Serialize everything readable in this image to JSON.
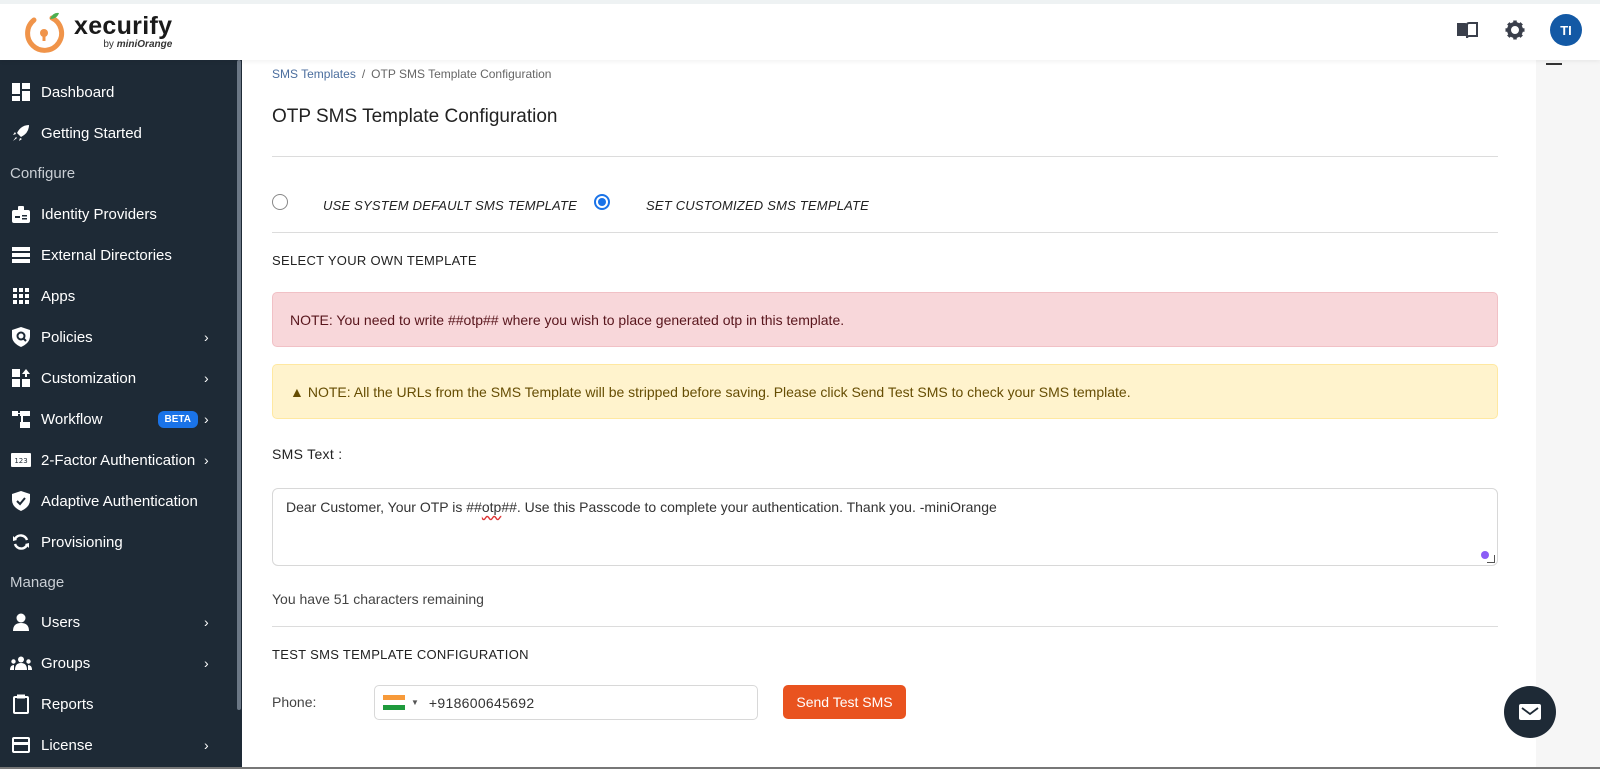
{
  "brand": {
    "name": "xecurify",
    "sub_prefix": "by ",
    "sub_brand": "miniOrange"
  },
  "header": {
    "avatar_initials": "TI",
    "icons": [
      "book-icon",
      "gear-icon"
    ]
  },
  "sidebar": {
    "items": [
      {
        "label": "Dashboard",
        "icon": "dashboard-icon"
      },
      {
        "label": "Getting Started",
        "icon": "rocket-icon"
      },
      {
        "section": "Configure"
      },
      {
        "label": "Identity Providers",
        "icon": "id-badge-icon"
      },
      {
        "label": "External Directories",
        "icon": "server-icon"
      },
      {
        "label": "Apps",
        "icon": "grid-icon"
      },
      {
        "label": "Policies",
        "icon": "shield-search-icon",
        "chevron": true
      },
      {
        "label": "Customization",
        "icon": "customization-icon",
        "chevron": true
      },
      {
        "label": "Workflow",
        "icon": "workflow-icon",
        "chevron": true,
        "badge": "BETA"
      },
      {
        "label": "2-Factor Authentication",
        "icon": "123-icon",
        "chevron": true
      },
      {
        "label": "Adaptive Authentication",
        "icon": "shield-check-icon"
      },
      {
        "label": "Provisioning",
        "icon": "sync-icon"
      },
      {
        "section": "Manage"
      },
      {
        "label": "Users",
        "icon": "user-icon",
        "chevron": true
      },
      {
        "label": "Groups",
        "icon": "users-icon",
        "chevron": true
      },
      {
        "label": "Reports",
        "icon": "clipboard-icon"
      },
      {
        "label": "License",
        "icon": "card-icon",
        "chevron": true
      }
    ],
    "chevron_glyph": "›"
  },
  "breadcrumb": {
    "parent": "SMS Templates",
    "separator": "/",
    "current": "OTP SMS Template Configuration"
  },
  "page_title": "OTP SMS Template Configuration",
  "template_choice": {
    "options": [
      {
        "label": "USE SYSTEM DEFAULT SMS TEMPLATE",
        "selected": false
      },
      {
        "label": "SET CUSTOMIZED SMS TEMPLATE",
        "selected": true
      }
    ]
  },
  "select_section_title": "SELECT YOUR OWN TEMPLATE",
  "alerts": {
    "otp_note": "NOTE: You need to write ##otp## where you wish to place generated otp in this template.",
    "url_note": "NOTE: All the URLs from the SMS Template will be stripped before saving. Please click Send Test SMS to check your SMS template."
  },
  "sms_text": {
    "label": "SMS Text :",
    "value_before": "Dear Customer, Your OTP is ##",
    "value_misspelled": "otp",
    "value_after": "##. Use this Passcode to complete your authentication. Thank you. -miniOrange",
    "remaining": "You have 51 characters remaining"
  },
  "test_section": {
    "title": "TEST SMS TEMPLATE CONFIGURATION",
    "phone_label": "Phone:",
    "country": "India",
    "phone_value": "+918600645692",
    "send_button": "Send Test SMS"
  },
  "colors": {
    "accent": "#1a73e8",
    "send_button": "#e9531f",
    "sidebar_bg": "#1e2a36",
    "avatar": "#1359a5"
  }
}
